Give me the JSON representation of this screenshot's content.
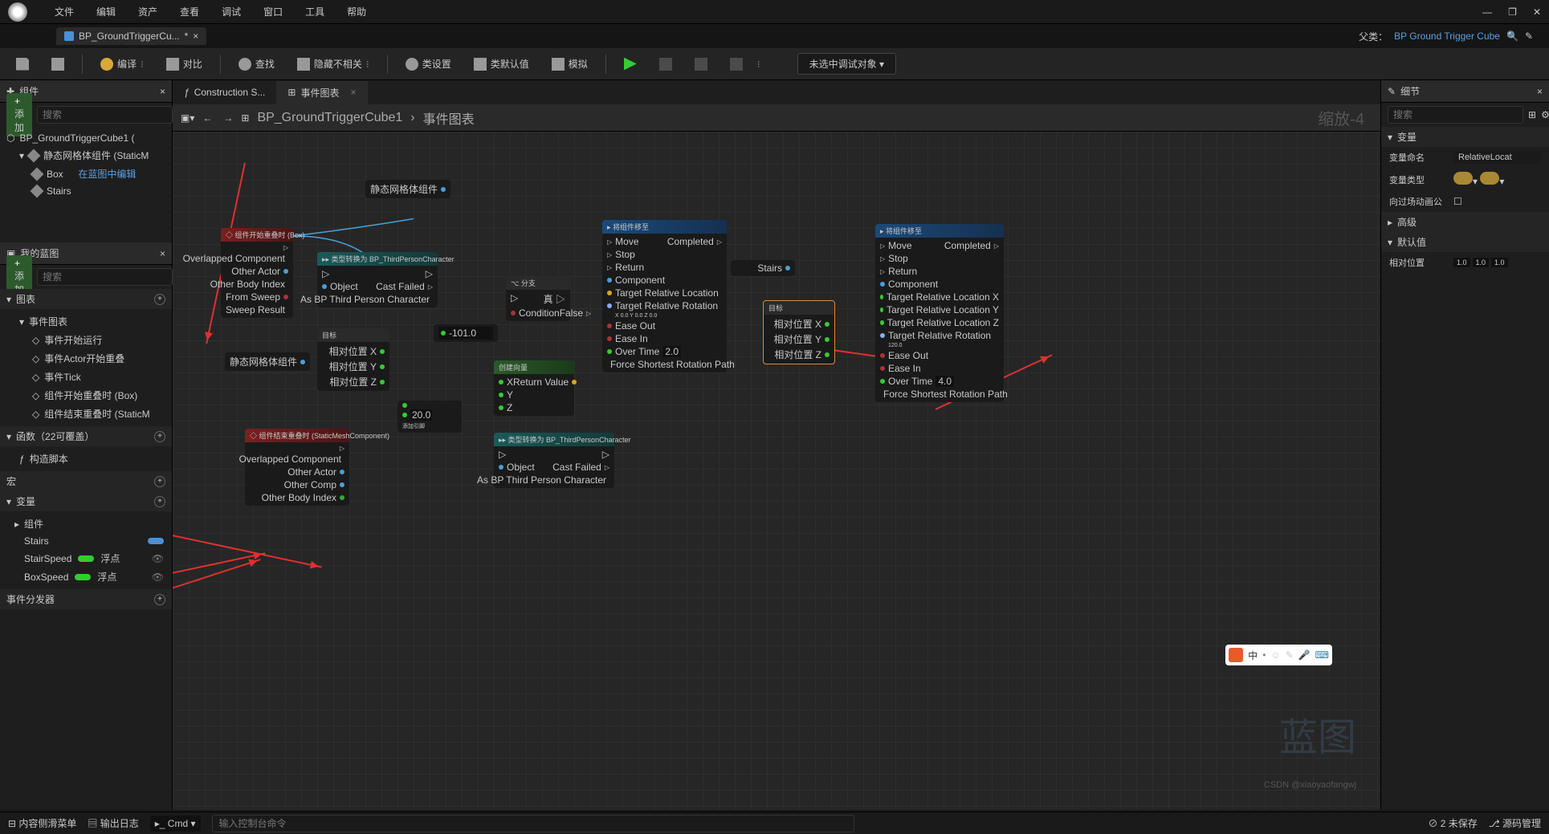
{
  "menu": {
    "items": [
      "文件",
      "编辑",
      "资产",
      "查看",
      "调试",
      "窗口",
      "工具",
      "帮助"
    ]
  },
  "tab": {
    "title": "BP_GroundTriggerCu...",
    "dirty": "*"
  },
  "parent": {
    "label": "父类：",
    "value": "BP Ground Trigger Cube"
  },
  "toolbar": {
    "compile": "编译",
    "diff": "对比",
    "find": "查找",
    "hide": "隐藏不相关",
    "classSettings": "类设置",
    "classDefaults": "类默认值",
    "simulate": "模拟",
    "debugTarget": "未选中调试对象"
  },
  "componentsPanel": {
    "title": "组件",
    "add": "添加",
    "searchPh": "搜索",
    "root": "BP_GroundTriggerCube1  (",
    "mesh": "静态网格体组件 (StaticM",
    "box": "Box",
    "boxLink": "在蓝图中编辑",
    "stairs": "Stairs"
  },
  "myBlueprint": {
    "title": "我的蓝图",
    "add": "添加",
    "searchPh": "搜索",
    "graphs": {
      "h": "图表",
      "eventGraph": "事件图表",
      "beginPlay": "事件开始运行",
      "actorOverlap": "事件Actor开始重叠",
      "tick": "事件Tick",
      "boxBegin": "组件开始重叠时 (Box)",
      "meshEnd": "组件结束重叠时 (StaticM"
    },
    "functions": {
      "h": "函数（22可覆盖）",
      "construct": "构造脚本"
    },
    "macros": {
      "h": "宏"
    },
    "vars": {
      "h": "变量",
      "compH": "组件",
      "stairs": "Stairs",
      "stairSpeed": "StairSpeed",
      "boxSpeed": "BoxSpeed",
      "float": "浮点"
    },
    "dispatch": {
      "h": "事件分发器"
    }
  },
  "centerTabs": {
    "construct": "Construction S...",
    "eventGraph": "事件图表"
  },
  "breadcrumb": {
    "root": "BP_GroundTriggerCube1",
    "leaf": "事件图表",
    "zoom": "缩放-4"
  },
  "nodes": {
    "boxBegin": {
      "title": "◇ 组件开始重叠时 (Box)",
      "pins": [
        "Overlapped Component",
        "Other Actor",
        "Other Body Index",
        "From Sweep",
        "Sweep Result"
      ]
    },
    "cast1": {
      "title": "▸▸ 类型转换为 BP_ThirdPersonCharacter",
      "pins": [
        "Object",
        "Cast Failed",
        "As BP Third Person Character"
      ]
    },
    "staticMesh": "静态网格体组件",
    "branch": {
      "title": "⌥ 分支",
      "pins": [
        "Condition",
        "真",
        "False"
      ]
    },
    "target1": {
      "title": "目标",
      "pins": [
        "相对位置 X",
        "相对位置 Y",
        "相对位置 Z"
      ]
    },
    "makeVec": {
      "title": "创建向量",
      "pins": [
        "X",
        "Y",
        "Z",
        "Return Value"
      ]
    },
    "add": {
      "label": "添加引脚",
      "val": "20.0"
    },
    "floatVal": "-101.0",
    "move1": {
      "title": "▸ 将组件移至",
      "pins": [
        "Move",
        "Stop",
        "Return",
        "Component",
        "Target Relative Location",
        "Target Relative Rotation",
        "Ease Out",
        "Ease In",
        "Over Time",
        "Force Shortest Rotation Path",
        "Completed"
      ],
      "over": "2.0",
      "rot": "X 0.0  Y 0.0  Z 0.0"
    },
    "stairsVar": "Stairs",
    "target2": {
      "title": "目标",
      "pins": [
        "相对位置 X",
        "相对位置 Y",
        "相对位置 Z"
      ]
    },
    "move2": {
      "title": "▸ 将组件移至",
      "pins": [
        "Move",
        "Stop",
        "Return",
        "Component",
        "Target Relative Location X",
        "Target Relative Location Y",
        "Target Relative Location Z",
        "Target Relative Rotation",
        "Ease Out",
        "Ease In",
        "Over Time",
        "Force Shortest Rotation Path",
        "Completed"
      ],
      "over": "4.0",
      "rot": "120.0"
    },
    "meshEnd": {
      "title": "◇ 组件结束重叠时 (StaticMeshComponent)",
      "pins": [
        "Overlapped Component",
        "Other Actor",
        "Other Comp",
        "Other Body Index"
      ]
    },
    "cast2": {
      "title": "▸▸ 类型转换为 BP_ThirdPersonCharacter",
      "pins": [
        "Object",
        "Cast Failed",
        "As BP Third Person Character"
      ]
    }
  },
  "details": {
    "title": "细节",
    "searchPh": "搜索",
    "varSection": "变量",
    "varName": {
      "l": "变量命名",
      "v": "RelativeLocat"
    },
    "varType": {
      "l": "变量类型"
    },
    "anim": {
      "l": "向过场动画公"
    },
    "adv": "高级",
    "def": "默认值",
    "relPos": {
      "l": "相对位置",
      "x": "1.0",
      "y": "1.0",
      "z": "1.0"
    }
  },
  "status": {
    "drawer": "内容侧滑菜单",
    "log": "输出日志",
    "cmd": "Cmd",
    "cmdPh": "输入控制台命令",
    "unsaved": "2 未保存",
    "src": "源码管理"
  },
  "watermark": "蓝图",
  "csdn": "CSDN @xiaoyaofangwj"
}
